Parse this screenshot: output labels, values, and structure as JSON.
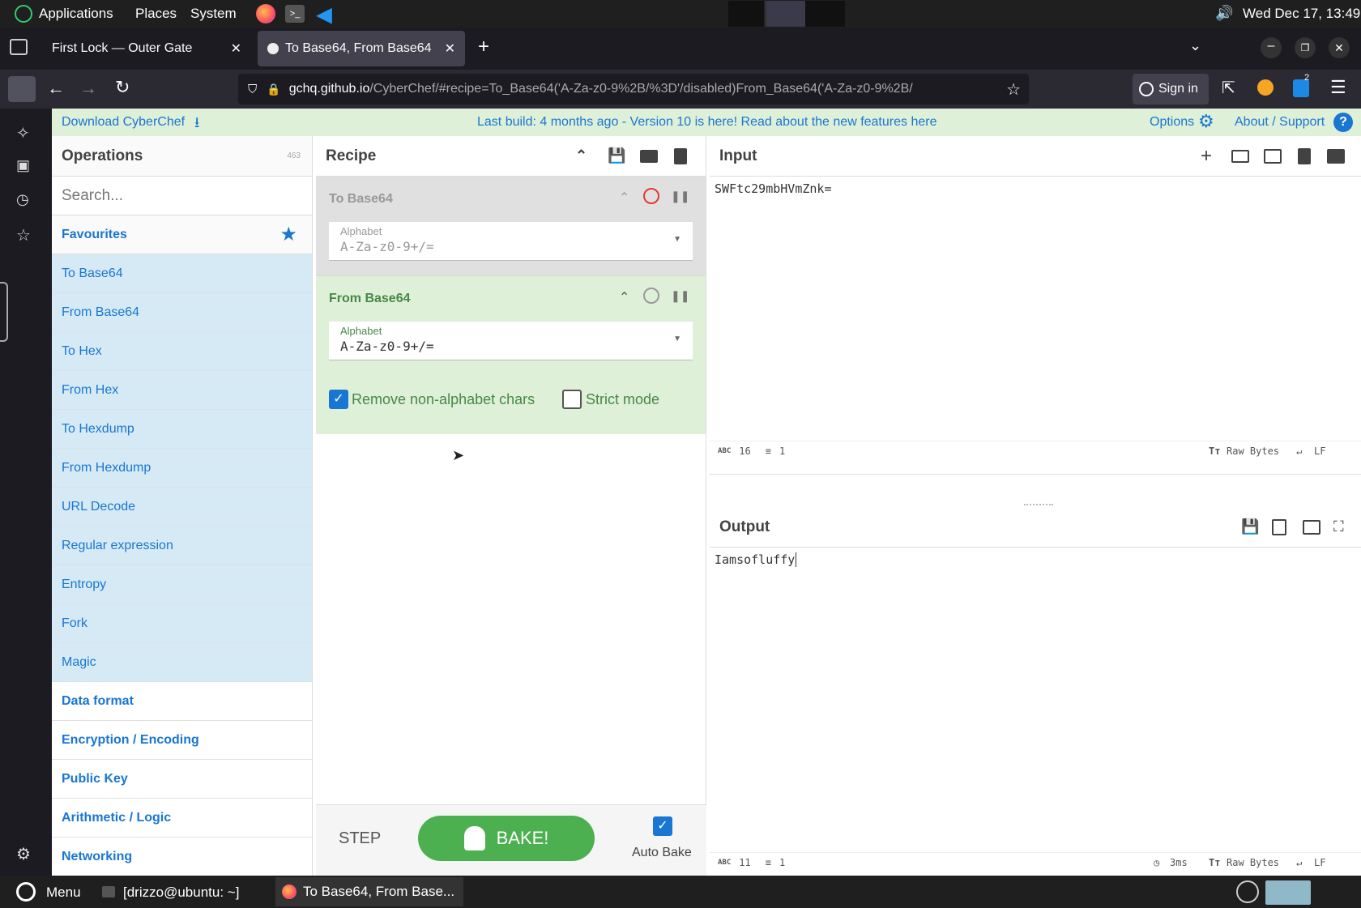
{
  "topbar": {
    "menus": [
      "Applications",
      "Places",
      "System"
    ],
    "datetime": "Wed Dec 17, 13:49"
  },
  "browser": {
    "tabs": [
      {
        "label": "First Lock — Outer Gate",
        "active": false
      },
      {
        "label": "To Base64, From Base64",
        "active": true
      }
    ],
    "url_host": "gchq.github.io",
    "url_path": "/CyberChef/#recipe=To_Base64('A-Za-z0-9%2B/%3D'/disabled)From_Base64('A-Za-z0-9%2B/",
    "sign_in": "Sign in",
    "notif_count": "2"
  },
  "banner": {
    "download": "Download CyberChef",
    "message": "Last build: 4 months ago - Version 10 is here! Read about the new features here",
    "options": "Options",
    "about": "About / Support"
  },
  "operations": {
    "title": "Operations",
    "count": "463",
    "search_placeholder": "Search...",
    "favourites_label": "Favourites",
    "items": [
      "To Base64",
      "From Base64",
      "To Hex",
      "From Hex",
      "To Hexdump",
      "From Hexdump",
      "URL Decode",
      "Regular expression",
      "Entropy",
      "Fork",
      "Magic"
    ],
    "categories": [
      "Data format",
      "Encryption / Encoding",
      "Public Key",
      "Arithmetic / Logic",
      "Networking"
    ]
  },
  "recipe": {
    "title": "Recipe",
    "ingredients": [
      {
        "name": "To Base64",
        "alphabet_label": "Alphabet",
        "alphabet": "A-Za-z0-9+/=",
        "disabled": true
      },
      {
        "name": "From Base64",
        "alphabet_label": "Alphabet",
        "alphabet": "A-Za-z0-9+/=",
        "disabled": false,
        "remove_non_alpha": "Remove non-alphabet chars",
        "strict_mode": "Strict mode"
      }
    ],
    "step": "STEP",
    "bake": "BAKE!",
    "auto_bake": "Auto Bake"
  },
  "input": {
    "title": "Input",
    "text": "SWFtc29mbHVmZnk=",
    "length": "16",
    "lines": "1",
    "encoding": "Raw Bytes",
    "eol": "LF"
  },
  "output": {
    "title": "Output",
    "text": "Iamsofluffy",
    "length": "11",
    "lines": "1",
    "time": "3ms",
    "encoding": "Raw Bytes",
    "eol": "LF"
  },
  "taskbar": {
    "menu": "Menu",
    "terminal": "[drizzo@ubuntu: ~]",
    "firefox": "To Base64, From Base..."
  },
  "colors": {
    "accent_blue": "#1976d2",
    "bake_green": "#4caf50",
    "ingredient_green_bg": "#dff0d8",
    "ingredient_green_text": "#468847",
    "disabled_bg": "#e0e0e0"
  }
}
